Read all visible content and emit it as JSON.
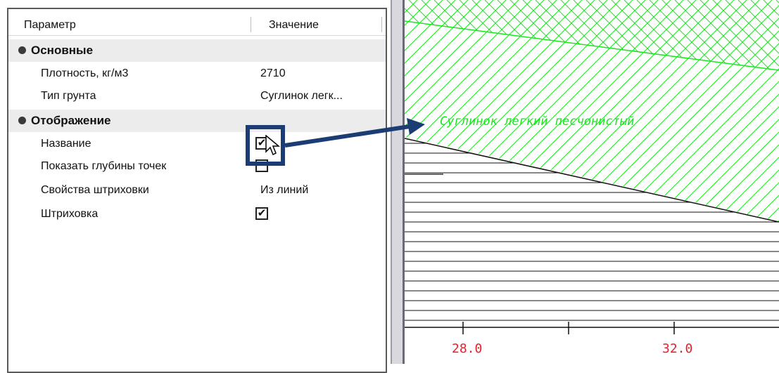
{
  "table_header": {
    "param": "Параметр",
    "value": "Значение"
  },
  "groups": [
    {
      "title": "Основные"
    },
    {
      "title": "Отображение"
    }
  ],
  "rows": [
    {
      "label": "Плотность, кг/м3",
      "value": "2710"
    },
    {
      "label": "Тип грунта",
      "value": "Суглинок легк..."
    },
    {
      "label": "Название",
      "checked": true
    },
    {
      "label": "Показать глубины точек",
      "checked": false
    },
    {
      "label": "Свойства штриховки",
      "value": "Из линий"
    },
    {
      "label": "Штриховка",
      "checked": true
    }
  ],
  "drawing": {
    "soil_label": "Суглинок легкий песчонистый",
    "axis_ticks": [
      "28.0",
      "32.0"
    ],
    "colors": {
      "hatch": "#19e61e",
      "axis_label": "#e8202a",
      "arrow": "#1b3d73"
    }
  }
}
